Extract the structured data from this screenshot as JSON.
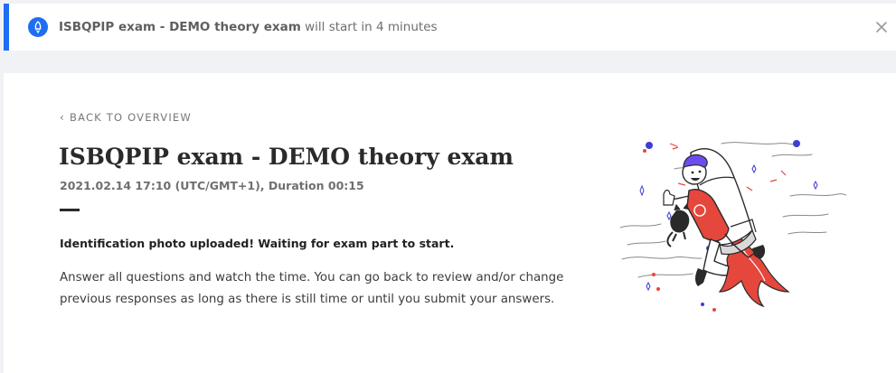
{
  "banner": {
    "exam_name": "ISBQPIP exam - DEMO theory exam",
    "message_suffix": " will start in 4 minutes",
    "icon": "rocket-icon",
    "close_icon": "close-icon",
    "accent_color": "#1e6ef2"
  },
  "exam": {
    "back_label": "BACK TO OVERVIEW",
    "title": "ISBQPIP exam - DEMO theory exam",
    "meta": "2021.02.14 17:10 (UTC/GMT+1), Duration 00:15",
    "status": "Identification photo uploaded! Waiting for exam part to start.",
    "instructions": "Answer all questions and watch the time. You can go back to review and/or change previous responses as long as there is still time or until you submit your answers."
  },
  "illustration": {
    "subject": "person-flying-with-rocket"
  }
}
